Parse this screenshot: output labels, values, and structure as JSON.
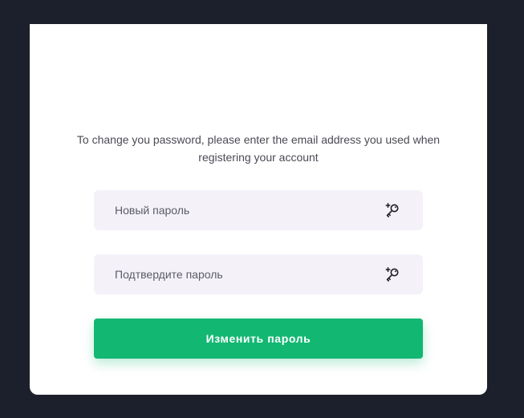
{
  "colors": {
    "background": "#1c1f2c",
    "card": "#ffffff",
    "field_bg": "#f4f2f8",
    "accent": "#12b772",
    "text": "#4a4a55"
  },
  "form": {
    "instruction": "To change you password, please enter the email address you used when registering your account",
    "new_password": {
      "placeholder": "Новый пароль",
      "value": "",
      "icon": "key-plus-icon"
    },
    "confirm_password": {
      "placeholder": "Подтвердите пароль",
      "value": "",
      "icon": "key-plus-icon"
    },
    "submit_label": "Изменить пароль"
  }
}
